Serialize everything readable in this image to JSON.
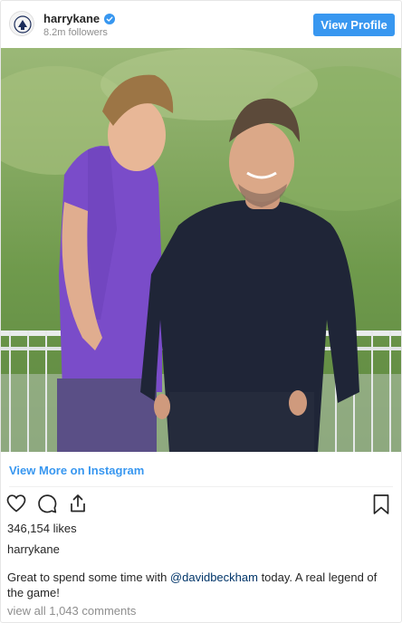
{
  "header": {
    "username": "harrykane",
    "followers": "8.2m followers",
    "view_profile_label": "View Profile"
  },
  "post": {
    "view_more_label": "View More on Instagram",
    "likes": "346,154 likes",
    "caption_user": "harrykane",
    "caption_before": "Great to spend some time with ",
    "caption_mention": "@davidbeckham",
    "caption_after": " today. A real legend of the game!",
    "comments_label": "view all 1,043 comments"
  },
  "colors": {
    "accent": "#3897f0",
    "mention": "#003569",
    "muted": "#8e8e8e",
    "text": "#262626"
  },
  "icons": [
    "verified-badge-icon",
    "heart-icon",
    "comment-icon",
    "share-icon",
    "bookmark-icon"
  ]
}
